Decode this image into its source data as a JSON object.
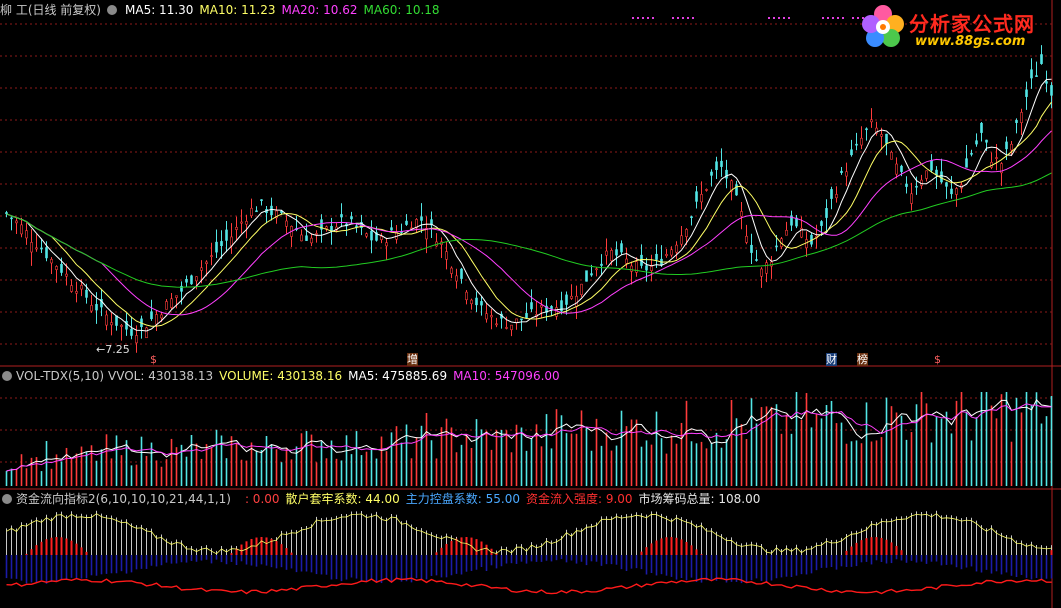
{
  "price_panel": {
    "title": "柳 工(日线 前复权)",
    "ma5_label": "MA5: 11.30",
    "ma10_label": "MA10: 11.23",
    "ma20_label": "MA20: 10.62",
    "ma60_label": "MA60: 10.18",
    "low_marker": "←7.25",
    "event_marks": [
      "$",
      "增",
      "财",
      "榜",
      "$"
    ]
  },
  "volume_panel": {
    "title": "VOL-TDX(5,10)",
    "vvol_label": "VVOL: 430138.13",
    "volume_label": "VOLUME: 430138.16",
    "ma5_label": "MA5: 475885.69",
    "ma10_label": "MA10: 547096.00"
  },
  "flow_panel": {
    "title": "资金流向指标2(6,10,10,10,21,44,1,1)",
    "v0_label": ": 0.00",
    "retail_label": "散户套牢系数: 44.00",
    "main_label": "主力控盘系数: 55.00",
    "inflow_label": "资金流入强度: 9.00",
    "chips_label": "市场筹码总量: 108.00"
  },
  "logo": {
    "main": "分析家公式网",
    "url": "www.88gs.com"
  },
  "colors": {
    "up": "#ff3b3b",
    "down": "#52e6e6",
    "ma5": "#ffffff",
    "ma10": "#ffff66",
    "ma20": "#ff40ff",
    "ma60": "#22cc22",
    "grid": "#8b1a1a",
    "flow_gray": "#c8c8c8",
    "flow_blue": "#1c1ca8",
    "flow_red": "#ff1a1a"
  },
  "chart_data": [
    {
      "type": "candlestick",
      "series": [
        {
          "name": "MA5",
          "latest": 11.3
        },
        {
          "name": "MA10",
          "latest": 11.23
        },
        {
          "name": "MA20",
          "latest": 10.62
        },
        {
          "name": "MA60",
          "latest": 10.18
        }
      ],
      "annotations": [
        "7.25"
      ],
      "close_shape": [
        12.1,
        11.7,
        11.2,
        10.8,
        10.3,
        9.9,
        9.4,
        9.0,
        8.5,
        8.1,
        7.8,
        7.5,
        7.3,
        7.4,
        7.8,
        8.2,
        8.6,
        9.0,
        9.5,
        10.0,
        10.4,
        10.9,
        11.3,
        11.9,
        12.4,
        12.6,
        12.3,
        12.1,
        11.8,
        11.4,
        11.2,
        11.4,
        11.7,
        11.9,
        11.8,
        11.5,
        11.2,
        11.1,
        11.4,
        11.6,
        11.9,
        12.0,
        11.6,
        11.0,
        10.2,
        9.5,
        8.8,
        8.2,
        7.9,
        7.7,
        7.6,
        7.8,
        8.0,
        8.2,
        8.3,
        8.4,
        8.7,
        9.2,
        9.8,
        10.3,
        10.6,
        10.4,
        10.1,
        9.9,
        10.0,
        10.3,
        10.8,
        11.4,
        12.2,
        13.0,
        13.8,
        14.2,
        13.4,
        12.2,
        10.8,
        9.8,
        10.4,
        11.3,
        11.9,
        11.4,
        11.0,
        11.6,
        12.8,
        13.8,
        14.6,
        15.4,
        16.0,
        15.6,
        14.6,
        13.8,
        13.2,
        13.8,
        14.2,
        13.6,
        13.0,
        13.6,
        14.8,
        15.6,
        14.6,
        14.4,
        15.2,
        16.6,
        17.8,
        18.6,
        17.4
      ]
    },
    {
      "type": "bar",
      "series": [
        {
          "name": "VVOL",
          "latest": 430138.13
        },
        {
          "name": "VOLUME",
          "latest": 430138.16
        },
        {
          "name": "MA5",
          "latest": 475885.69
        },
        {
          "name": "MA10",
          "latest": 547096.0
        }
      ]
    },
    {
      "type": "area",
      "series": [
        {
          "name": "散户套牢系数",
          "latest": 44.0
        },
        {
          "name": "主力控盘系数",
          "latest": 55.0
        },
        {
          "name": "资金流入强度",
          "latest": 9.0
        },
        {
          "name": "市场筹码总量",
          "latest": 108.0
        }
      ]
    }
  ]
}
